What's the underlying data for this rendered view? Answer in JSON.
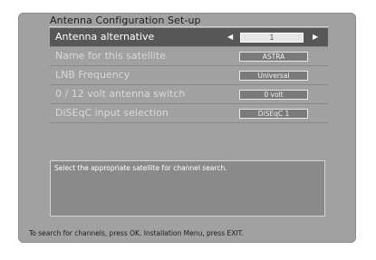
{
  "title": "Antenna Configuration Set-up",
  "menu": {
    "items": [
      {
        "label": "Antenna alternative",
        "value": "1",
        "selected": true
      },
      {
        "label": "Name for this satellite",
        "value": "ASTRA",
        "selected": false
      },
      {
        "label": "LNB Frequency",
        "value": "Universal",
        "selected": false
      },
      {
        "label": "0 / 12 volt antenna switch",
        "value": "0 volt",
        "selected": false
      },
      {
        "label": "DiSEqC input selection",
        "value": "DiSEqC 1",
        "selected": false
      }
    ],
    "left_arrow_icon": "triangle-left-icon",
    "right_arrow_icon": "triangle-right-icon"
  },
  "help": {
    "text": "Select the appropriate satellite for channel search."
  },
  "footer": {
    "text": "To search for channels, press OK. Installation Menu, press EXIT."
  },
  "colors": {
    "panel": "#a1a1a1",
    "highlight": "#575757",
    "value_box": "#7a7a7a"
  }
}
